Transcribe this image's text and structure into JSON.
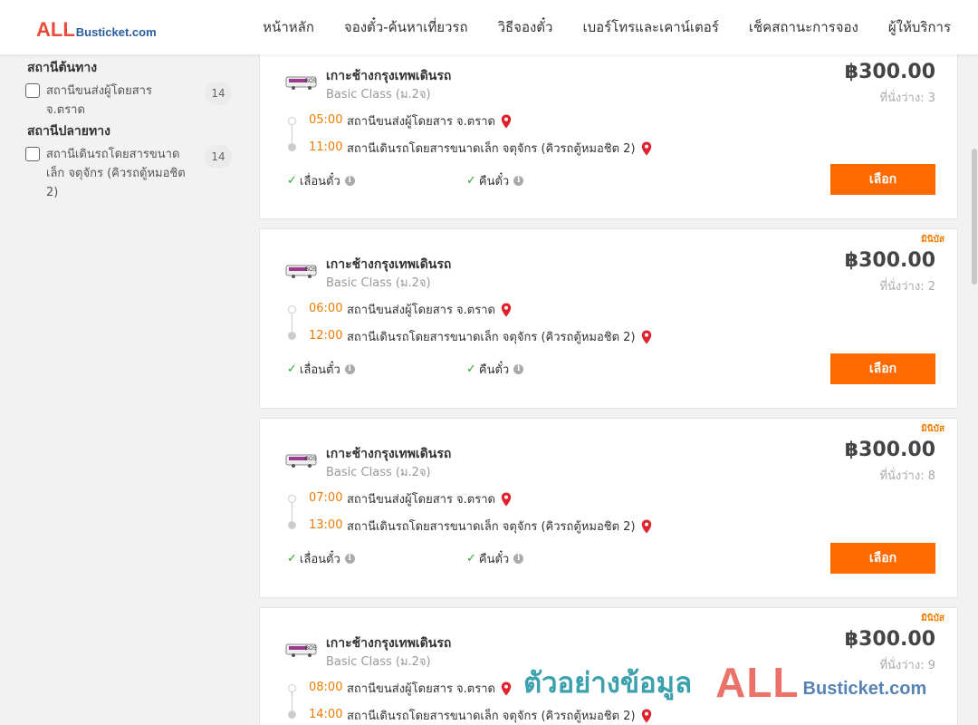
{
  "header": {
    "logo_all": "ALL",
    "logo_rest": "Busticket.com",
    "nav": [
      "หน้าหลัก",
      "จองตั๋ว-ค้นหาเที่ยวรถ",
      "วิธีจองตั๋ว",
      "เบอร์โทรและเคาน์เตอร์",
      "เช็คสถานะการจอง",
      "ผู้ให้บริการ"
    ]
  },
  "sidebar": {
    "origin_title": "สถานีต้นทาง",
    "origin_option": {
      "label": "สถานีขนส่งผู้โดยสาร จ.ตราด",
      "count": "14"
    },
    "destination_title": "สถานีปลายทาง",
    "destination_option": {
      "label": "สถานีเดินรถโดยสารขนาดเล็ก จตุจักร (คิวรถตู้หมอชิต 2)",
      "count": "14"
    }
  },
  "trips": [
    {
      "badge": "",
      "route": "เกาะช้างกรุงเทพเดินรถ",
      "class": "Basic Class (ม.2จ)",
      "price": "฿300.00",
      "seats": "ที่นั่งว่าง: 3",
      "depart_time": "05:00",
      "depart_station": "สถานีขนส่งผู้โดยสาร จ.ตราด",
      "arrive_time": "11:00",
      "arrive_station": "สถานีเดินรถโดยสารขนาดเล็ก จตุจักร (คิวรถตู้หมอชิต 2)",
      "feature1": "เลื่อนตั๋ว",
      "feature2": "คืนตั๋ว",
      "button": "เลือก"
    },
    {
      "badge": "มินิบัส",
      "route": "เกาะช้างกรุงเทพเดินรถ",
      "class": "Basic Class (ม.2จ)",
      "price": "฿300.00",
      "seats": "ที่นั่งว่าง: 2",
      "depart_time": "06:00",
      "depart_station": "สถานีขนส่งผู้โดยสาร จ.ตราด",
      "arrive_time": "12:00",
      "arrive_station": "สถานีเดินรถโดยสารขนาดเล็ก จตุจักร (คิวรถตู้หมอชิต 2)",
      "feature1": "เลื่อนตั๋ว",
      "feature2": "คืนตั๋ว",
      "button": "เลือก"
    },
    {
      "badge": "มินิบัส",
      "route": "เกาะช้างกรุงเทพเดินรถ",
      "class": "Basic Class (ม.2จ)",
      "price": "฿300.00",
      "seats": "ที่นั่งว่าง: 8",
      "depart_time": "07:00",
      "depart_station": "สถานีขนส่งผู้โดยสาร จ.ตราด",
      "arrive_time": "13:00",
      "arrive_station": "สถานีเดินรถโดยสารขนาดเล็ก จตุจักร (คิวรถตู้หมอชิต 2)",
      "feature1": "เลื่อนตั๋ว",
      "feature2": "คืนตั๋ว",
      "button": "เลือก"
    },
    {
      "badge": "มินิบัส",
      "route": "เกาะช้างกรุงเทพเดินรถ",
      "class": "Basic Class (ม.2จ)",
      "price": "฿300.00",
      "seats": "ที่นั่งว่าง: 9",
      "depart_time": "08:00",
      "depart_station": "สถานีขนส่งผู้โดยสาร จ.ตราด",
      "arrive_time": "14:00",
      "arrive_station": "สถานีเดินรถโดยสารขนาดเล็ก จตุจักร (คิวรถตู้หมอชิต 2)",
      "feature1": "",
      "feature2": "",
      "button": ""
    }
  ],
  "watermark": {
    "text": "ตัวอย่างข้อมูล",
    "all": "ALL",
    "rest": "Busticket.com"
  },
  "colors": {
    "accent": "#ff6a00",
    "time": "#f07b00",
    "check": "#2aa52a",
    "pin": "#e0222f"
  }
}
